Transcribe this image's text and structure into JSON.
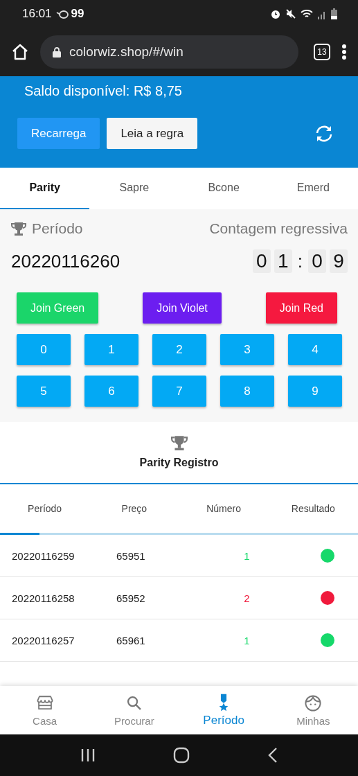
{
  "status_bar": {
    "time": "16:01",
    "notification": "99"
  },
  "browser": {
    "url": "colorwiz.shop/#/win",
    "tab_count": "13"
  },
  "header": {
    "balance": "Saldo disponível: R$ 8,75",
    "buttons": [
      {
        "label": "Recarrega",
        "kind": "primary"
      },
      {
        "label": "Leia a regra",
        "kind": "secondary"
      }
    ]
  },
  "tabs": [
    {
      "label": "Parity",
      "selected": true
    },
    {
      "label": "Sapre",
      "selected": false
    },
    {
      "label": "Bcone",
      "selected": false
    },
    {
      "label": "Emerd",
      "selected": false
    }
  ],
  "game": {
    "period_label": "Período",
    "countdown_label": "Contagem regressiva",
    "period": "20220116260",
    "countdown": [
      {
        "text": "0",
        "kind": "digit"
      },
      {
        "text": "1",
        "kind": "digit"
      },
      {
        "text": ":",
        "kind": "separator"
      },
      {
        "text": "0",
        "kind": "digit"
      },
      {
        "text": "9",
        "kind": "digit"
      }
    ],
    "join_buttons": [
      {
        "label": "Join Green",
        "color": "#1bd56a"
      },
      {
        "label": "Join Violet",
        "color": "#6c1ef0"
      },
      {
        "label": "Join Red",
        "color": "#f5193f"
      }
    ],
    "numbers": [
      "0",
      "1",
      "2",
      "3",
      "4",
      "5",
      "6",
      "7",
      "8",
      "9"
    ]
  },
  "record": {
    "title": "Parity Registro",
    "columns": [
      "Período",
      "Preço",
      "Número",
      "Resultado"
    ],
    "progress": {
      "level": 0.11
    },
    "rows": [
      {
        "period": "20220116259",
        "price": "65951",
        "number": "1",
        "color": "#16d86a"
      },
      {
        "period": "20220116258",
        "price": "65952",
        "number": "2",
        "color": "#f01a3c"
      },
      {
        "period": "20220116257",
        "price": "65961",
        "number": "1",
        "color": "#16d86a"
      }
    ]
  },
  "bottom_nav": [
    {
      "label": "Casa",
      "selected": false
    },
    {
      "label": "Procurar",
      "selected": false
    },
    {
      "label": "Período",
      "selected": true
    },
    {
      "label": "Minhas",
      "selected": false
    }
  ]
}
